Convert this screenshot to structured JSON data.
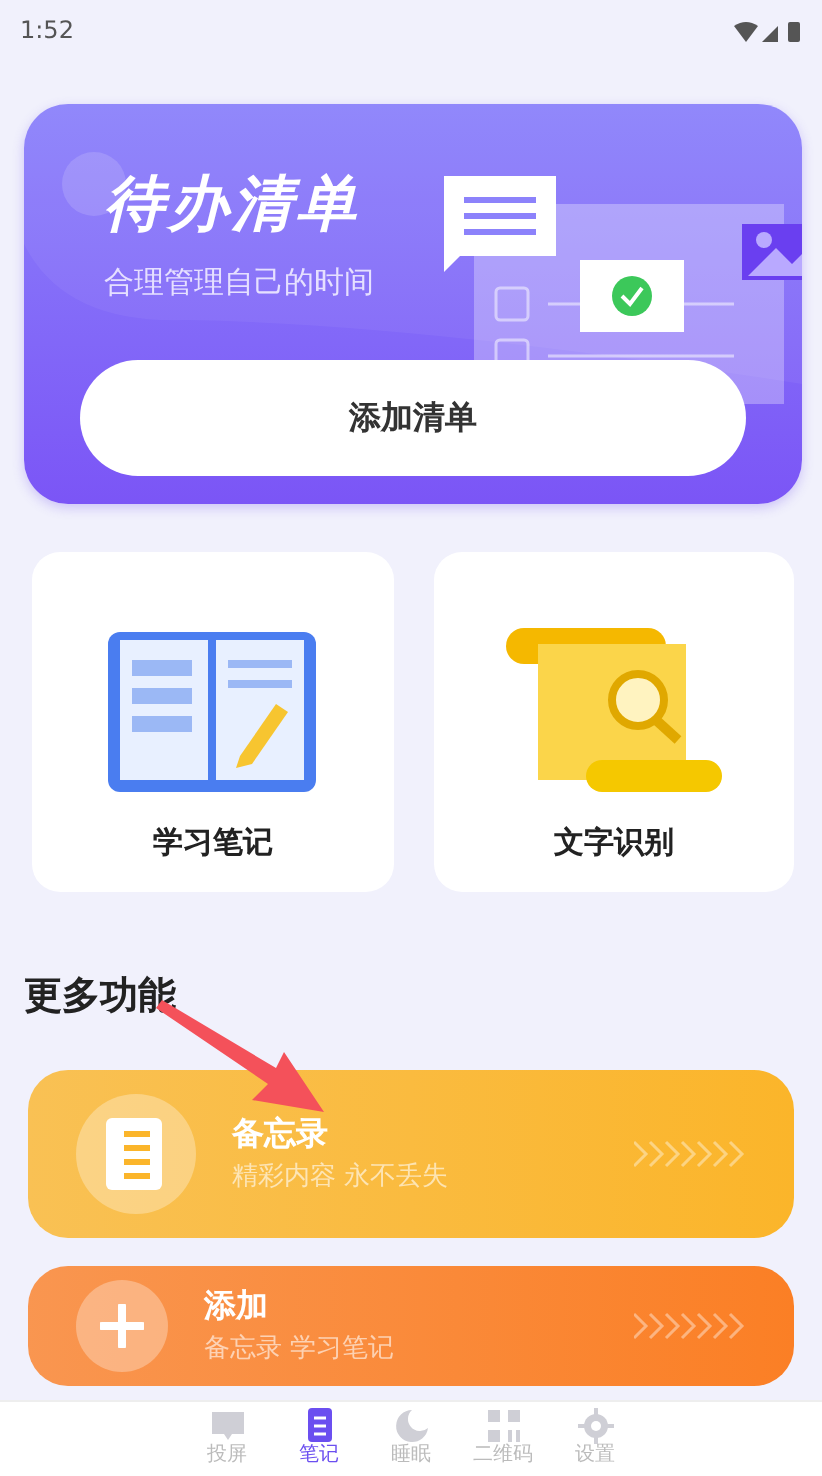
{
  "status_bar": {
    "time": "1:52"
  },
  "banner": {
    "title": "待办清单",
    "subtitle": "合理管理自己的时间",
    "button": "添加清单"
  },
  "tools": [
    {
      "kind": "notebook",
      "label": "学习笔记"
    },
    {
      "kind": "scroll",
      "label": "文字识别"
    }
  ],
  "section_title": "更多功能",
  "features": [
    {
      "kind": "memo",
      "title": "备忘录",
      "subtitle": "精彩内容 永不丢失",
      "color": "#fbb52a"
    },
    {
      "kind": "add",
      "title": "添加",
      "subtitle": "备忘录 学习笔记",
      "color": "#fb7f25"
    }
  ],
  "annotation": {
    "kind": "arrow"
  },
  "bottom_nav": [
    {
      "kind": "screen",
      "label": "投屏",
      "selected": false
    },
    {
      "kind": "note",
      "label": "笔记",
      "selected": true
    },
    {
      "kind": "moon",
      "label": "睡眠",
      "selected": false
    },
    {
      "kind": "qr",
      "label": "二维码",
      "selected": false
    },
    {
      "kind": "gear",
      "label": "设置",
      "selected": false
    }
  ]
}
